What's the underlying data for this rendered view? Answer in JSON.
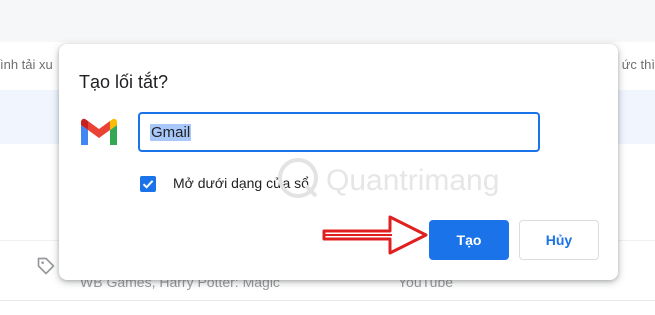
{
  "background": {
    "bar_left_text": "ình tải xu",
    "bar_right_text": "ức thì",
    "row_text_left": "WB Games, Harry Potter: Magic",
    "row_text_right": "YouTube"
  },
  "dialog": {
    "title": "Tạo lối tắt?",
    "app_icon": "gmail-icon",
    "name_value": "Gmail",
    "open_as_window_label": "Mở dưới dạng cửa sổ",
    "open_as_window_checked": true,
    "create_label": "Tạo",
    "cancel_label": "Hủy"
  },
  "watermark": "Quantrimang",
  "colors": {
    "accent": "#1a73e8",
    "selection": "#a8c7fa",
    "annotation_arrow": "#e02020"
  }
}
